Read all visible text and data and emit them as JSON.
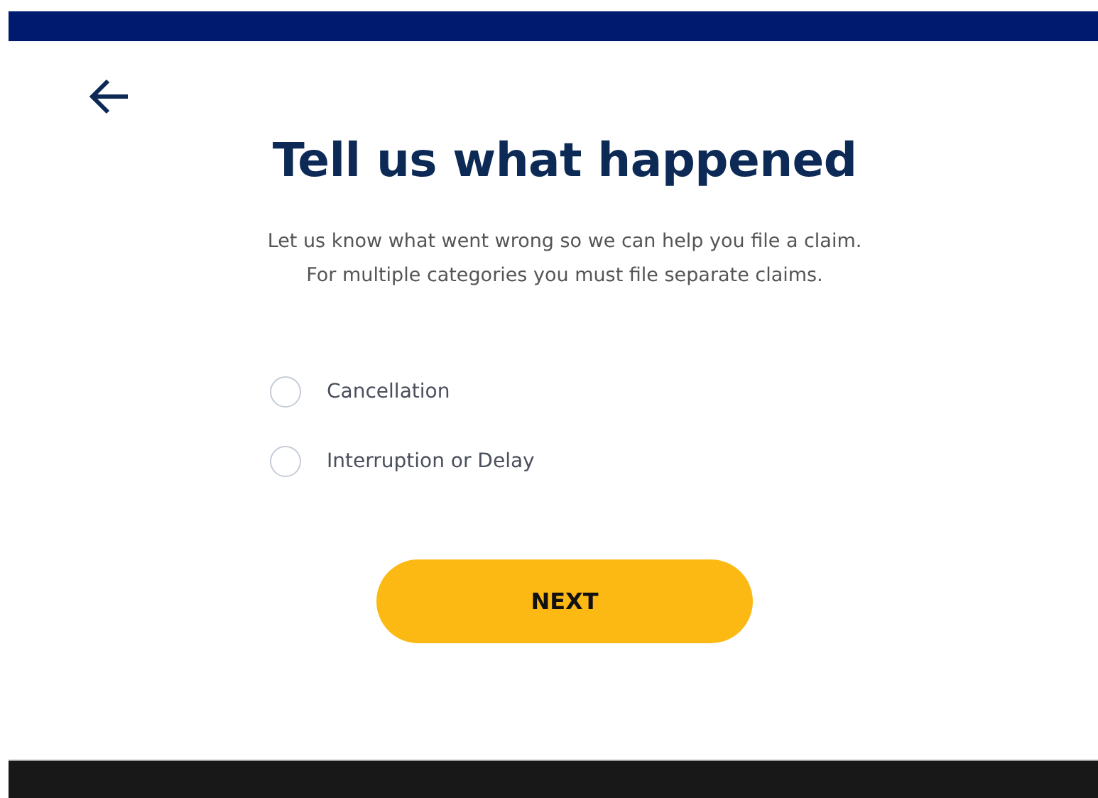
{
  "title": "Tell us what happened",
  "description": [
    "Let us know what went wrong so we can help you file a claim.",
    "For multiple categories you must file separate claims."
  ],
  "options": [
    {
      "label": "Cancellation",
      "selected": false
    },
    {
      "label": "Interruption or Delay",
      "selected": false
    }
  ],
  "button": "NEXT"
}
